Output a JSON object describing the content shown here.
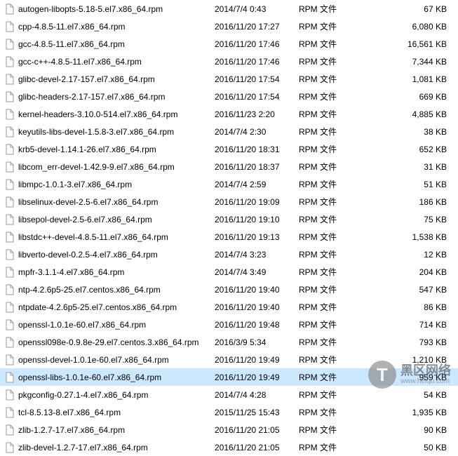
{
  "files": [
    {
      "name": "autogen-libopts-5.18-5.el7.x86_64.rpm",
      "date": "2014/7/4 0:43",
      "type": "RPM 文件",
      "size": "67 KB",
      "selected": false
    },
    {
      "name": "cpp-4.8.5-11.el7.x86_64.rpm",
      "date": "2016/11/20 17:27",
      "type": "RPM 文件",
      "size": "6,080 KB",
      "selected": false
    },
    {
      "name": "gcc-4.8.5-11.el7.x86_64.rpm",
      "date": "2016/11/20 17:46",
      "type": "RPM 文件",
      "size": "16,561 KB",
      "selected": false
    },
    {
      "name": "gcc-c++-4.8.5-11.el7.x86_64.rpm",
      "date": "2016/11/20 17:46",
      "type": "RPM 文件",
      "size": "7,344 KB",
      "selected": false
    },
    {
      "name": "glibc-devel-2.17-157.el7.x86_64.rpm",
      "date": "2016/11/20 17:54",
      "type": "RPM 文件",
      "size": "1,081 KB",
      "selected": false
    },
    {
      "name": "glibc-headers-2.17-157.el7.x86_64.rpm",
      "date": "2016/11/20 17:54",
      "type": "RPM 文件",
      "size": "669 KB",
      "selected": false
    },
    {
      "name": "kernel-headers-3.10.0-514.el7.x86_64.rpm",
      "date": "2016/11/23 2:20",
      "type": "RPM 文件",
      "size": "4,885 KB",
      "selected": false
    },
    {
      "name": "keyutils-libs-devel-1.5.8-3.el7.x86_64.rpm",
      "date": "2014/7/4 2:30",
      "type": "RPM 文件",
      "size": "38 KB",
      "selected": false
    },
    {
      "name": "krb5-devel-1.14.1-26.el7.x86_64.rpm",
      "date": "2016/11/20 18:31",
      "type": "RPM 文件",
      "size": "652 KB",
      "selected": false
    },
    {
      "name": "libcom_err-devel-1.42.9-9.el7.x86_64.rpm",
      "date": "2016/11/20 18:37",
      "type": "RPM 文件",
      "size": "31 KB",
      "selected": false
    },
    {
      "name": "libmpc-1.0.1-3.el7.x86_64.rpm",
      "date": "2014/7/4 2:59",
      "type": "RPM 文件",
      "size": "51 KB",
      "selected": false
    },
    {
      "name": "libselinux-devel-2.5-6.el7.x86_64.rpm",
      "date": "2016/11/20 19:09",
      "type": "RPM 文件",
      "size": "186 KB",
      "selected": false
    },
    {
      "name": "libsepol-devel-2.5-6.el7.x86_64.rpm",
      "date": "2016/11/20 19:10",
      "type": "RPM 文件",
      "size": "75 KB",
      "selected": false
    },
    {
      "name": "libstdc++-devel-4.8.5-11.el7.x86_64.rpm",
      "date": "2016/11/20 19:13",
      "type": "RPM 文件",
      "size": "1,538 KB",
      "selected": false
    },
    {
      "name": "libverto-devel-0.2.5-4.el7.x86_64.rpm",
      "date": "2014/7/4 3:23",
      "type": "RPM 文件",
      "size": "12 KB",
      "selected": false
    },
    {
      "name": "mpfr-3.1.1-4.el7.x86_64.rpm",
      "date": "2014/7/4 3:49",
      "type": "RPM 文件",
      "size": "204 KB",
      "selected": false
    },
    {
      "name": "ntp-4.2.6p5-25.el7.centos.x86_64.rpm",
      "date": "2016/11/20 19:40",
      "type": "RPM 文件",
      "size": "547 KB",
      "selected": false
    },
    {
      "name": "ntpdate-4.2.6p5-25.el7.centos.x86_64.rpm",
      "date": "2016/11/20 19:40",
      "type": "RPM 文件",
      "size": "86 KB",
      "selected": false
    },
    {
      "name": "openssl-1.0.1e-60.el7.x86_64.rpm",
      "date": "2016/11/20 19:48",
      "type": "RPM 文件",
      "size": "714 KB",
      "selected": false
    },
    {
      "name": "openssl098e-0.9.8e-29.el7.centos.3.x86_64.rpm",
      "date": "2016/3/9 5:34",
      "type": "RPM 文件",
      "size": "793 KB",
      "selected": false
    },
    {
      "name": "openssl-devel-1.0.1e-60.el7.x86_64.rpm",
      "date": "2016/11/20 19:49",
      "type": "RPM 文件",
      "size": "1,210 KB",
      "selected": false
    },
    {
      "name": "openssl-libs-1.0.1e-60.el7.x86_64.rpm",
      "date": "2016/11/20 19:49",
      "type": "RPM 文件",
      "size": "959 KB",
      "selected": true
    },
    {
      "name": "pkgconfig-0.27.1-4.el7.x86_64.rpm",
      "date": "2014/7/4 4:28",
      "type": "RPM 文件",
      "size": "54 KB",
      "selected": false
    },
    {
      "name": "tcl-8.5.13-8.el7.x86_64.rpm",
      "date": "2015/11/25 15:43",
      "type": "RPM 文件",
      "size": "1,935 KB",
      "selected": false
    },
    {
      "name": "zlib-1.2.7-17.el7.x86_64.rpm",
      "date": "2016/11/20 21:05",
      "type": "RPM 文件",
      "size": "90 KB",
      "selected": false
    },
    {
      "name": "zlib-devel-1.2.7-17.el7.x86_64.rpm",
      "date": "2016/11/20 21:05",
      "type": "RPM 文件",
      "size": "50 KB",
      "selected": false
    }
  ],
  "watermark": {
    "brand": "黑区网络",
    "url": "www.heiqu.com",
    "logo": "T"
  }
}
